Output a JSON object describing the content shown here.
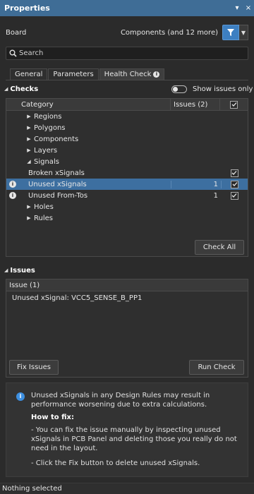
{
  "panel": {
    "title": "Properties",
    "pin_glyph": "▾",
    "close_glyph": "×"
  },
  "board": {
    "label": "Board",
    "filter_text": "Components (and 12 more)"
  },
  "search": {
    "placeholder": "Search"
  },
  "tabs": [
    {
      "label": "General",
      "active": false
    },
    {
      "label": "Parameters",
      "active": false
    },
    {
      "label": "Health Check",
      "active": true
    }
  ],
  "checks": {
    "heading": "Checks",
    "toggle_label": "Show issues only",
    "toggle_on": false,
    "columns": {
      "category": "Category",
      "issues": "Issues (2)"
    },
    "rows": [
      {
        "label": "Regions",
        "expanded": false,
        "child": false,
        "issues": "",
        "checkbox": false,
        "info": false,
        "selected": false
      },
      {
        "label": "Polygons",
        "expanded": false,
        "child": false,
        "issues": "",
        "checkbox": false,
        "info": false,
        "selected": false
      },
      {
        "label": "Components",
        "expanded": false,
        "child": false,
        "issues": "",
        "checkbox": false,
        "info": false,
        "selected": false
      },
      {
        "label": "Layers",
        "expanded": false,
        "child": false,
        "issues": "",
        "checkbox": false,
        "info": false,
        "selected": false
      },
      {
        "label": "Signals",
        "expanded": true,
        "child": false,
        "issues": "",
        "checkbox": false,
        "info": false,
        "selected": false
      },
      {
        "label": "Broken xSignals",
        "expanded": null,
        "child": true,
        "issues": "",
        "checkbox": true,
        "info": false,
        "selected": false
      },
      {
        "label": "Unused xSignals",
        "expanded": null,
        "child": true,
        "issues": "1",
        "checkbox": true,
        "info": true,
        "selected": true
      },
      {
        "label": "Unused From-Tos",
        "expanded": null,
        "child": true,
        "issues": "1",
        "checkbox": true,
        "info": true,
        "selected": false
      },
      {
        "label": "Holes",
        "expanded": false,
        "child": false,
        "issues": "",
        "checkbox": false,
        "info": false,
        "selected": false
      },
      {
        "label": "Rules",
        "expanded": false,
        "child": false,
        "issues": "",
        "checkbox": false,
        "info": false,
        "selected": false
      }
    ],
    "check_all_label": "Check All"
  },
  "issues": {
    "heading": "Issues",
    "column": "Issue (1)",
    "rows": [
      "Unused xSignal: VCC5_SENSE_B_PP1"
    ],
    "fix_label": "Fix Issues",
    "run_label": "Run Check"
  },
  "note": {
    "text": "Unused xSignals in any Design Rules may result in performance worsening due to extra calculations.",
    "how_heading": "How to fix:",
    "step1": "- You can fix the issue manually by inspecting unused xSignals in PCB Panel and deleting those you really do not need in the layout.",
    "step2": "- Click the Fix button to delete unused xSignals."
  },
  "status": {
    "text": "Nothing selected"
  },
  "colors": {
    "title_bar": "#3f6d96",
    "accent": "#3d7fc1",
    "selected_row": "#3d6fa0",
    "info_blue": "#3d8fe0"
  }
}
